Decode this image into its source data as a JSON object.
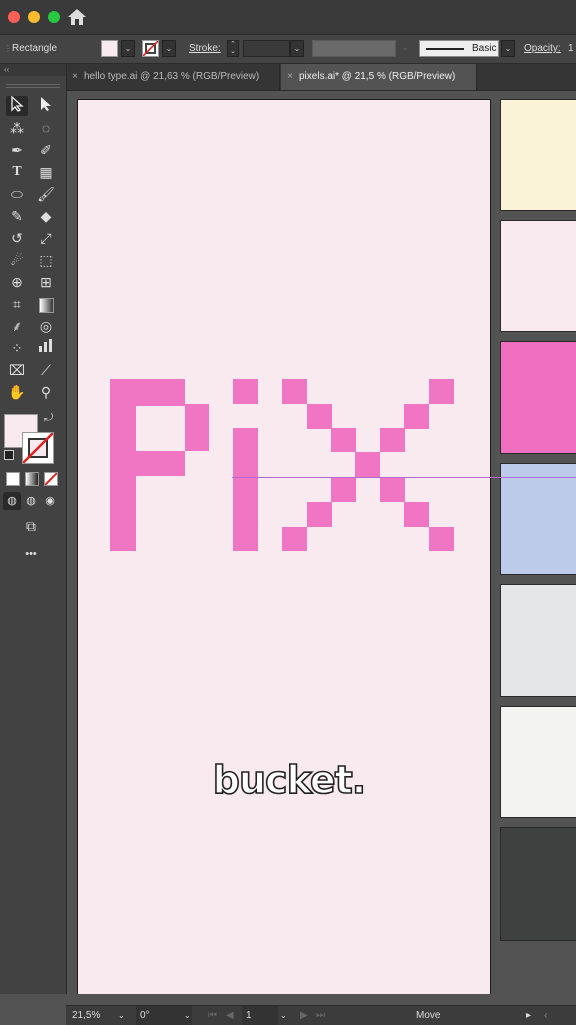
{
  "window": {
    "traffic_lights": [
      "#ff5f57",
      "#febc2e",
      "#28c840"
    ],
    "home_icon": "home-icon"
  },
  "control_bar": {
    "object_type": "Rectangle",
    "fill_color": "#f9eaef",
    "stroke_label": "Stroke:",
    "stroke_style": "Basic",
    "opacity_label": "Opacity:",
    "opacity_value": "1"
  },
  "tabs": [
    {
      "label": "hello type.ai @ 21,63 % (RGB/Preview)",
      "active": false
    },
    {
      "label": "pixels.ai* @ 21,5 % (RGB/Preview)",
      "active": true
    }
  ],
  "toolbar": {
    "collapse_label": "‹‹",
    "more_label": "•••",
    "tools": [
      "selection-tool",
      "direct-selection-tool",
      "magic-wand-tool",
      "lasso-tool",
      "pen-tool",
      "curvature-tool",
      "type-tool",
      "grid-tool",
      "ellipse-tool",
      "paintbrush-tool",
      "pencil-tool",
      "eraser-tool",
      "rotate-tool",
      "scale-tool",
      "warp-tool",
      "free-transform-tool",
      "shape-builder-tool",
      "perspective-grid-tool",
      "mesh-tool",
      "gradient-tool",
      "eyedropper-tool",
      "blend-tool",
      "symbol-sprayer-tool",
      "column-graph-tool",
      "artboard-tool",
      "slice-tool",
      "hand-tool",
      "zoom-tool"
    ]
  },
  "artboard": {
    "background": "#f9eaef",
    "pixel_color": "#f075c3",
    "caption": "bucket."
  },
  "palette": {
    "swatches": [
      "#fbf3d8",
      "#f9eaef",
      "#f06fc0",
      "#bccbe9",
      "#e5e6e8",
      "#f3f3f2",
      "#3f4140"
    ]
  },
  "status_bar": {
    "zoom": "21,5%",
    "rotation": "0°",
    "artboard_number": "1",
    "tool_status": "Move"
  }
}
